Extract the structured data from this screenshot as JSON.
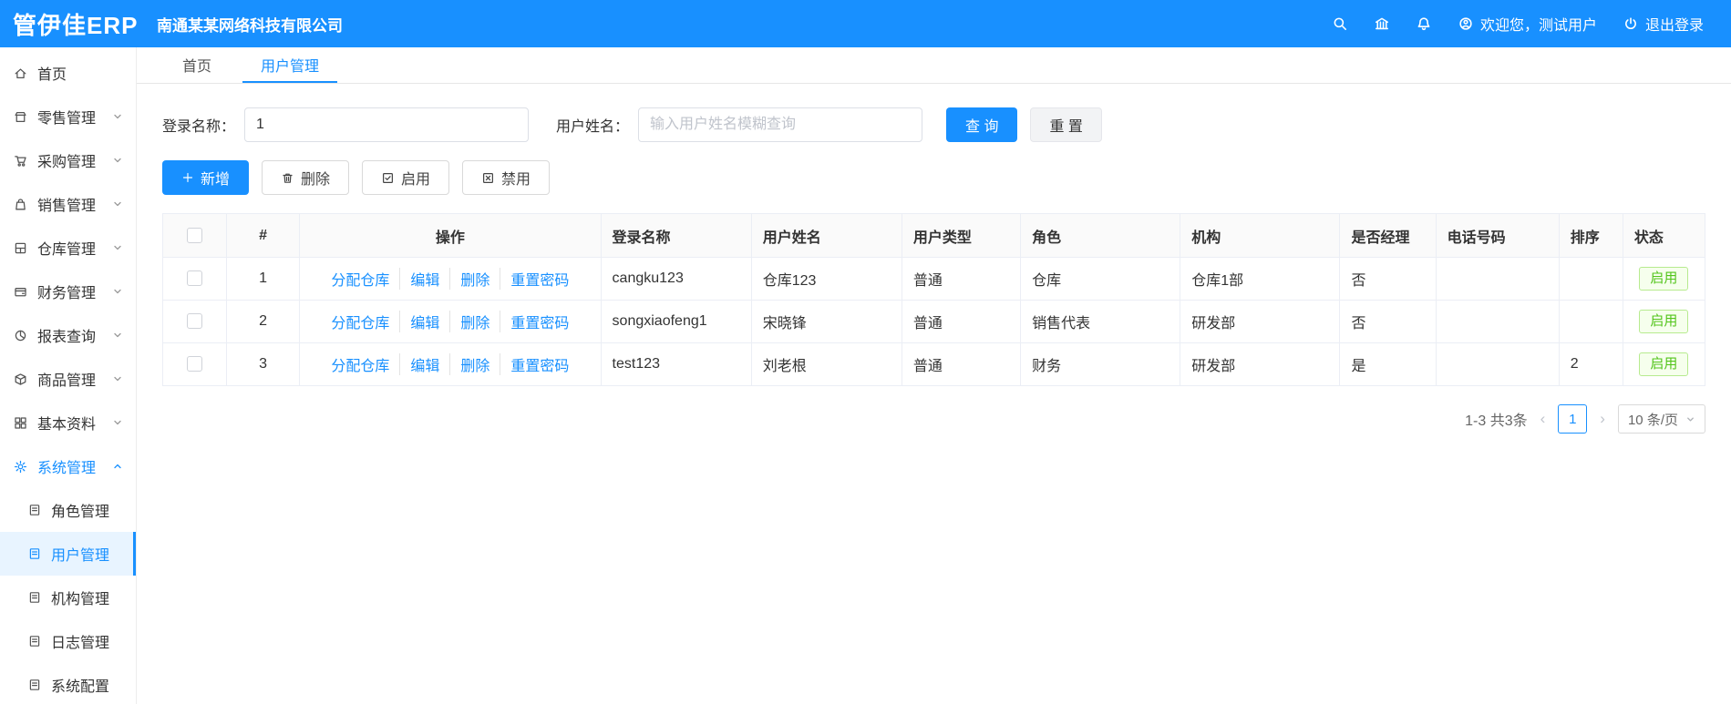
{
  "colors": {
    "accent": "#1890ff",
    "accent-bg": "#e8f4ff",
    "success": "#52c41a",
    "success-border": "#b7eb8f",
    "success-bg": "#f6ffed"
  },
  "header": {
    "logo": "管伊佳ERP",
    "company": "南通某某网络科技有限公司",
    "welcome": "欢迎您，测试用户",
    "logout": "退出登录"
  },
  "sidebar": {
    "items": [
      {
        "label": "首页",
        "icon": "home-icon"
      },
      {
        "label": "零售管理",
        "icon": "retail-icon"
      },
      {
        "label": "采购管理",
        "icon": "purchase-icon"
      },
      {
        "label": "销售管理",
        "icon": "sales-icon"
      },
      {
        "label": "仓库管理",
        "icon": "warehouse-icon"
      },
      {
        "label": "财务管理",
        "icon": "finance-icon"
      },
      {
        "label": "报表查询",
        "icon": "report-icon"
      },
      {
        "label": "商品管理",
        "icon": "product-icon"
      },
      {
        "label": "基本资料",
        "icon": "basic-data-icon"
      },
      {
        "label": "系统管理",
        "icon": "system-icon",
        "expanded": true
      }
    ],
    "system_children": [
      {
        "label": "角色管理"
      },
      {
        "label": "用户管理",
        "active": true
      },
      {
        "label": "机构管理"
      },
      {
        "label": "日志管理"
      },
      {
        "label": "系统配置"
      }
    ]
  },
  "tabs": {
    "items": [
      {
        "label": "首页"
      },
      {
        "label": "用户管理",
        "active": true
      }
    ]
  },
  "filters": {
    "login_name_label": "登录名称：",
    "login_name_value": "1",
    "user_name_label": "用户姓名：",
    "user_name_placeholder": "输入用户姓名模糊查询",
    "search_btn": "查 询",
    "reset_btn": "重 置"
  },
  "toolbar": {
    "add": "新增",
    "delete": "删除",
    "enable": "启用",
    "disable": "禁用"
  },
  "table": {
    "headers": [
      "#",
      "操作",
      "登录名称",
      "用户姓名",
      "用户类型",
      "角色",
      "机构",
      "是否经理",
      "电话号码",
      "排序",
      "状态"
    ],
    "action_links": [
      "分配仓库",
      "编辑",
      "删除",
      "重置密码"
    ],
    "rows": [
      {
        "index": "1",
        "login": "cangku123",
        "name": "仓库123",
        "type": "普通",
        "role": "仓库",
        "org": "仓库1部",
        "manager": "否",
        "phone": "",
        "sort": "",
        "status": "启用"
      },
      {
        "index": "2",
        "login": "songxiaofeng1",
        "name": "宋晓锋",
        "type": "普通",
        "role": "销售代表",
        "org": "研发部",
        "manager": "否",
        "phone": "",
        "sort": "",
        "status": "启用"
      },
      {
        "index": "3",
        "login": "test123",
        "name": "刘老根",
        "type": "普通",
        "role": "财务",
        "org": "研发部",
        "manager": "是",
        "phone": "",
        "sort": "2",
        "status": "启用"
      }
    ]
  },
  "pagination": {
    "summary": "1-3 共3条",
    "page": "1",
    "page_size": "10 条/页"
  }
}
